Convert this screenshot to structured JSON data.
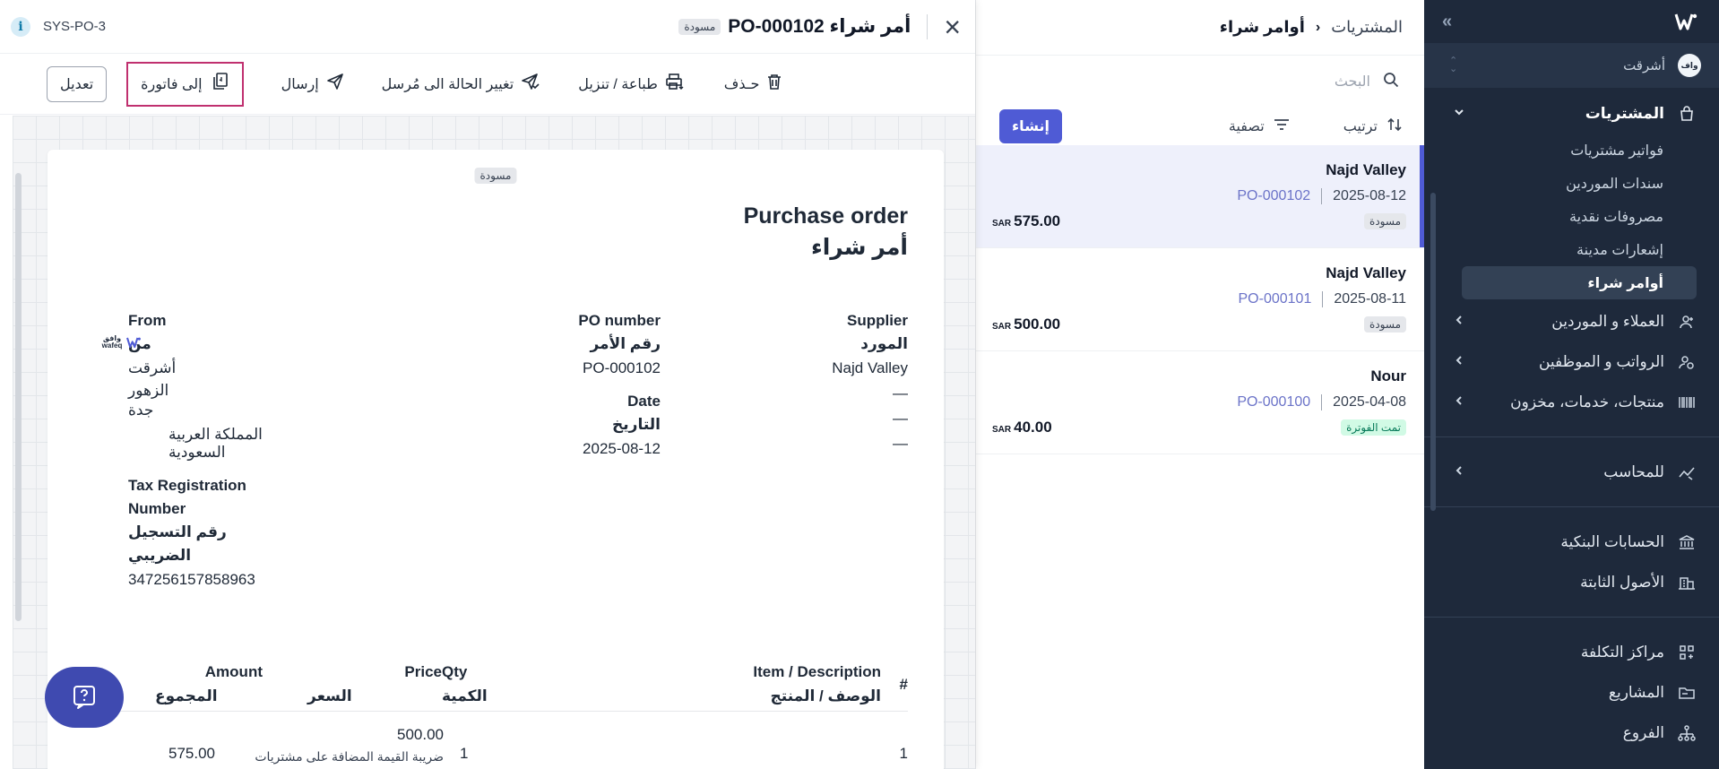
{
  "sidebar": {
    "org_name": "أشرقت",
    "org_initials": "واف",
    "purchases": {
      "label": "المشتريات",
      "items": [
        "فواتير مشتريات",
        "سندات الموردين",
        "مصروفات نقدية",
        "إشعارات مدينة",
        "أوامر شراء"
      ]
    },
    "nav": {
      "customers": "العملاء و الموردين",
      "payroll": "الرواتب و الموظفين",
      "products": "منتجات، خدمات، مخزون",
      "accountant": "للمحاسب",
      "bank": "الحسابات البنكية",
      "assets": "الأصول الثابتة",
      "cost_centers": "مراكز التكلفة",
      "projects": "المشاريع",
      "branches": "الفروع"
    }
  },
  "list": {
    "breadcrumb_parent": "المشتريات",
    "breadcrumb_current": "أوامر شراء",
    "search_placeholder": "البحث",
    "sort_label": "ترتيب",
    "filter_label": "تصفية",
    "create_label": "إنشاء",
    "currency": "SAR",
    "orders": [
      {
        "supplier": "Najd Valley",
        "date": "2025-08-12",
        "number": "PO-000102",
        "status": "مسودة",
        "amount": "575.00"
      },
      {
        "supplier": "Najd Valley",
        "date": "2025-08-11",
        "number": "PO-000101",
        "status": "مسودة",
        "amount": "500.00"
      },
      {
        "supplier": "Nour",
        "date": "2025-04-08",
        "number": "PO-000100",
        "status": "تمت الفوترة",
        "amount": "40.00"
      }
    ]
  },
  "detail": {
    "sys_ref": "SYS-PO-3",
    "title": "أمر شراء PO-000102",
    "status_badge": "مسودة",
    "toolbar": {
      "edit": "تعديل",
      "to_invoice": "إلى فاتورة",
      "send": "إرسال",
      "mark_sent": "تغيير الحالة الى مُرسل",
      "print": "طباعة / تنزيل",
      "delete": "حـذف"
    },
    "doc": {
      "badge": "مسودة",
      "heading_en": "Purchase order",
      "heading_ar": "أمر شراء",
      "supplier_label_en": "Supplier",
      "supplier_label_ar": "المورد",
      "supplier_name": "Najd Valley",
      "dash": "—",
      "po_label_en": "PO number",
      "po_label_ar": "رقم الأمر",
      "po_number": "PO-000102",
      "date_label_en": "Date",
      "date_label_ar": "التاريخ",
      "date_value": "2025-08-12",
      "from_label_en": "From",
      "from_label_ar": "من",
      "from_name": "أشرقت",
      "from_district": "الزهور",
      "from_city": "جدة",
      "from_country": "المملكة العربية السعودية",
      "tax_label_en": "Tax Registration Number",
      "tax_label_ar": "رقم التسجيل الضريبي",
      "tax_number": "347256157858963",
      "logo_text": "وافق wafeq",
      "columns": {
        "num": "#",
        "item_en": "Item / Description",
        "item_ar": "الوصف / المنتج",
        "qty_en": "Qty",
        "qty_ar": "الكمية",
        "price_en": "Price",
        "price_ar": "السعر",
        "amount_en": "Amount",
        "amount_ar": "المجموع"
      },
      "line": {
        "num": "1",
        "qty": "1",
        "price": "500.00",
        "tax": "ضريبة القيمة المضافة على مشتريات",
        "amount": "575.00"
      }
    }
  },
  "colors": {
    "sidebar_bg": "#1e293b",
    "accent": "#4f5bd5",
    "highlight_border": "#c0306f"
  }
}
